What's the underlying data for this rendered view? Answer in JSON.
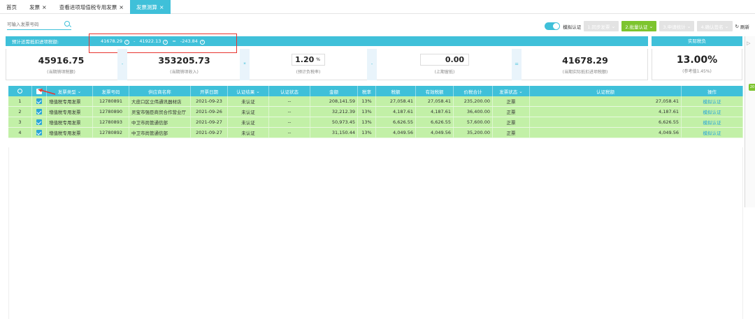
{
  "tabs": [
    {
      "label": "首页",
      "closable": false,
      "active": false
    },
    {
      "label": "发票",
      "closable": true,
      "active": false
    },
    {
      "label": "查看进项增值税专用发票",
      "closable": true,
      "active": false
    },
    {
      "label": "发票测算",
      "closable": true,
      "active": true
    }
  ],
  "search": {
    "placeholder": "可输入发票号码"
  },
  "toolbar": {
    "simulate_label": "模拟认证",
    "btn1": "1.同步发票",
    "btn2": "2.批量认证",
    "btn3": "3.申请统计",
    "btn4": "4.确认签名",
    "refresh": "刷新"
  },
  "summary": {
    "label": "预计还需抵扣进项税额:",
    "a": "41678.29",
    "minus": "-",
    "b": "41922.13",
    "eq": "=",
    "result": "-243.84",
    "actual_tax_label": "实际税负"
  },
  "metrics": {
    "m1_value": "45916.75",
    "m1_label": "(当期销项税额)",
    "m2_value": "353205.73",
    "m2_label": "(当期销项收入)",
    "m3_value": "1.20",
    "m3_unit": "%",
    "m3_label": "(预计负税率)",
    "m4_value": "0.00",
    "m4_label": "(上期留抵)",
    "m5_value": "41678.29",
    "m5_label": "(当期实际抵扣进项税额)",
    "tax_value": "13.00%",
    "tax_label": "(参考值1.45%)",
    "op1": "-",
    "op2": "*",
    "op3": "-",
    "op4": "="
  },
  "table": {
    "headers": {
      "type": "发票类型",
      "number": "发票号码",
      "supplier": "供应商名称",
      "date": "开票日期",
      "cert_result": "认证结果",
      "cert_status": "认证状态",
      "amount": "金额",
      "rate": "税率",
      "tax": "税额",
      "valid_tax": "有效税额",
      "total": "价税合计",
      "invoice_status": "发票状态",
      "cert_tax": "认证税额",
      "action": "操作"
    },
    "rows": [
      {
        "idx": "1",
        "type": "增值税专用发票",
        "number": "12780891",
        "supplier": "大皮口区立伟通讯器材店",
        "date": "2021-09-23",
        "cert_result": "未认证",
        "cert_status": "--",
        "amount": "208,141.59",
        "rate": "13%",
        "tax": "27,058.41",
        "valid_tax": "27,058.41",
        "total": "235,200.00",
        "invoice_status": "正票",
        "cert_tax": "27,058.41",
        "action": "模拟认证"
      },
      {
        "idx": "2",
        "type": "增值税专用发票",
        "number": "12780890",
        "supplier": "灵宝市强臣商贸合作营业厅",
        "date": "2021-09-26",
        "cert_result": "未认证",
        "cert_status": "--",
        "amount": "32,212.39",
        "rate": "13%",
        "tax": "4,187.61",
        "valid_tax": "4,187.61",
        "total": "36,400.00",
        "invoice_status": "正票",
        "cert_tax": "4,187.61",
        "action": "模拟认证"
      },
      {
        "idx": "3",
        "type": "增值税专用发票",
        "number": "12780893",
        "supplier": "中卫市尚管通信部",
        "date": "2021-09-27",
        "cert_result": "未认证",
        "cert_status": "--",
        "amount": "50,973.45",
        "rate": "13%",
        "tax": "6,626.55",
        "valid_tax": "6,626.55",
        "total": "57,600.00",
        "invoice_status": "正票",
        "cert_tax": "6,626.55",
        "action": "模拟认证"
      },
      {
        "idx": "4",
        "type": "增值税专用发票",
        "number": "12780892",
        "supplier": "中卫市尚管通信部",
        "date": "2021-09-27",
        "cert_result": "未认证",
        "cert_status": "--",
        "amount": "31,150.44",
        "rate": "13%",
        "tax": "4,049.56",
        "valid_tax": "4,049.56",
        "total": "35,200.00",
        "invoice_status": "正票",
        "cert_tax": "4,049.56",
        "action": "模拟认证"
      }
    ]
  },
  "side_badge": "20",
  "colors": {
    "accent": "#3fc0d9",
    "row_bg": "#c2f0a7",
    "primary_btn": "#7dc42e",
    "highlight": "#e8342f"
  }
}
